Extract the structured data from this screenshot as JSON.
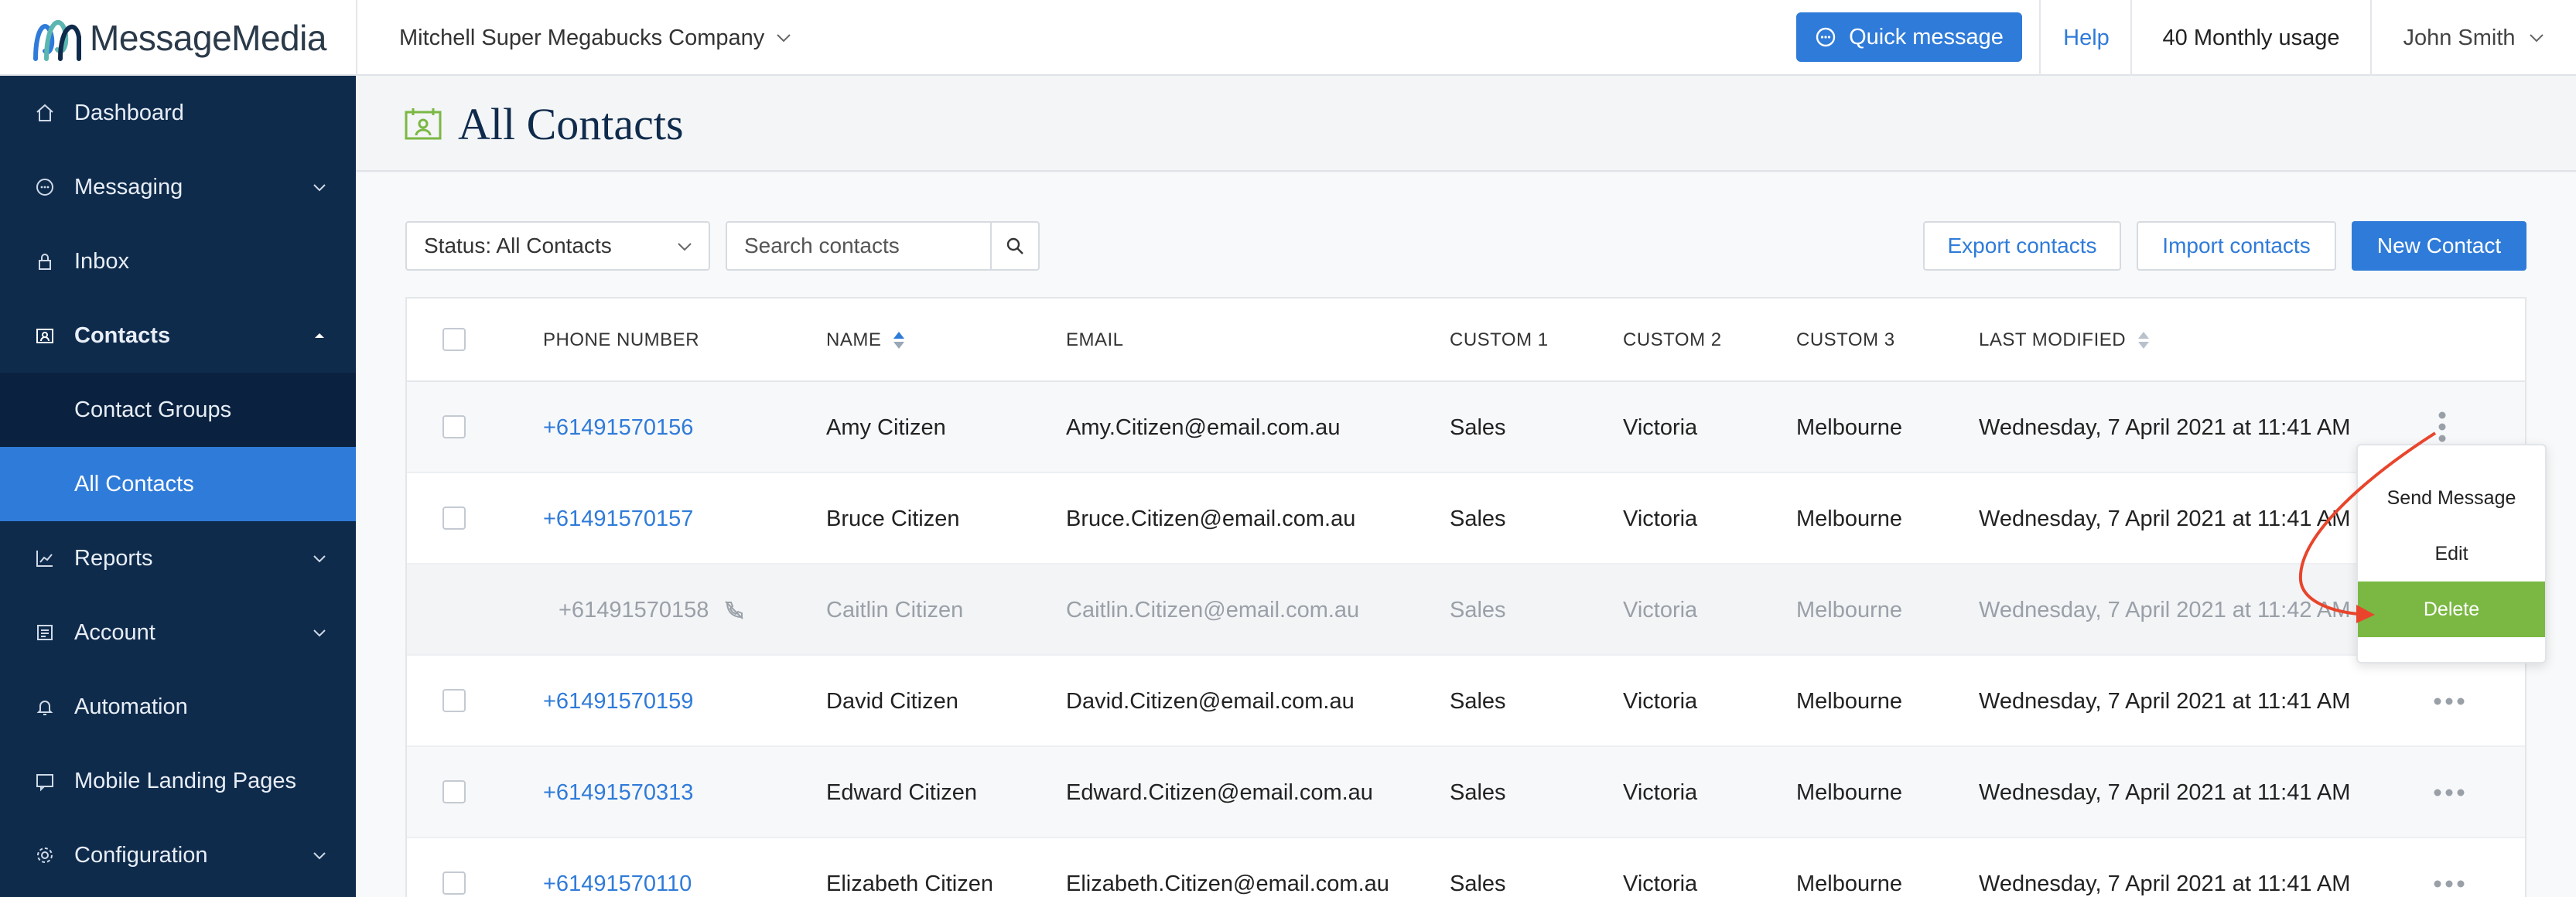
{
  "brand": {
    "name": "MessageMedia"
  },
  "topbar": {
    "company": "Mitchell Super Megabucks Company",
    "quick_message": "Quick message",
    "help": "Help",
    "usage": "40 Monthly usage",
    "user": "John Smith"
  },
  "sidebar": {
    "items": [
      {
        "label": "Dashboard",
        "icon": "home-icon"
      },
      {
        "label": "Messaging",
        "icon": "chat-icon",
        "expandable": true
      },
      {
        "label": "Inbox",
        "icon": "lock-icon"
      },
      {
        "label": "Contacts",
        "icon": "contacts-card-icon",
        "expanded": true
      },
      {
        "label": "Contact Groups"
      },
      {
        "label": "All Contacts",
        "active": true
      },
      {
        "label": "Reports",
        "icon": "chart-icon",
        "expandable": true
      },
      {
        "label": "Account",
        "icon": "account-icon",
        "expandable": true
      },
      {
        "label": "Automation",
        "icon": "bell-icon"
      },
      {
        "label": "Mobile Landing Pages",
        "icon": "landing-page-icon"
      },
      {
        "label": "Configuration",
        "icon": "gear-icon",
        "expandable": true
      }
    ]
  },
  "page": {
    "title": "All Contacts",
    "title_icon": "contacts-calendar-icon"
  },
  "toolbar": {
    "status_select": "Status: All Contacts",
    "search_placeholder": "Search contacts",
    "export": "Export contacts",
    "import": "Import contacts",
    "new_contact": "New Contact"
  },
  "table": {
    "headers": [
      "PHONE NUMBER",
      "NAME",
      "EMAIL",
      "CUSTOM 1",
      "CUSTOM 2",
      "CUSTOM 3",
      "LAST MODIFIED"
    ],
    "rows": [
      {
        "phone": "+61491570156",
        "name": "Amy Citizen",
        "email": "Amy.Citizen@email.com.au",
        "c1": "Sales",
        "c2": "Victoria",
        "c3": "Melbourne",
        "modified": "Wednesday, 7 April 2021 at 11:41 AM"
      },
      {
        "phone": "+61491570157",
        "name": "Bruce Citizen",
        "email": "Bruce.Citizen@email.com.au",
        "c1": "Sales",
        "c2": "Victoria",
        "c3": "Melbourne",
        "modified": "Wednesday, 7 April 2021 at 11:41 AM"
      },
      {
        "phone": "+61491570158",
        "name": "Caitlin Citizen",
        "email": "Caitlin.Citizen@email.com.au",
        "c1": "Sales",
        "c2": "Victoria",
        "c3": "Melbourne",
        "modified": "Wednesday, 7 April 2021 at 11:42 AM",
        "unsubscribed": true
      },
      {
        "phone": "+61491570159",
        "name": "David Citizen",
        "email": "David.Citizen@email.com.au",
        "c1": "Sales",
        "c2": "Victoria",
        "c3": "Melbourne",
        "modified": "Wednesday, 7 April 2021 at 11:41 AM"
      },
      {
        "phone": "+61491570313",
        "name": "Edward Citizen",
        "email": "Edward.Citizen@email.com.au",
        "c1": "Sales",
        "c2": "Victoria",
        "c3": "Melbourne",
        "modified": "Wednesday, 7 April 2021 at 11:41 AM"
      },
      {
        "phone": "+61491570110",
        "name": "Elizabeth Citizen",
        "email": "Elizabeth.Citizen@email.com.au",
        "c1": "Sales",
        "c2": "Victoria",
        "c3": "Melbourne",
        "modified": "Wednesday, 7 April 2021 at 11:41 AM"
      }
    ]
  },
  "menu": {
    "items": [
      "Send Message",
      "Edit",
      "Delete"
    ]
  },
  "colors": {
    "brand_blue": "#2f7bd9",
    "sidebar": "#0f2b4c",
    "delete_green": "#7ab843",
    "annotation_arrow": "#e8452c"
  }
}
